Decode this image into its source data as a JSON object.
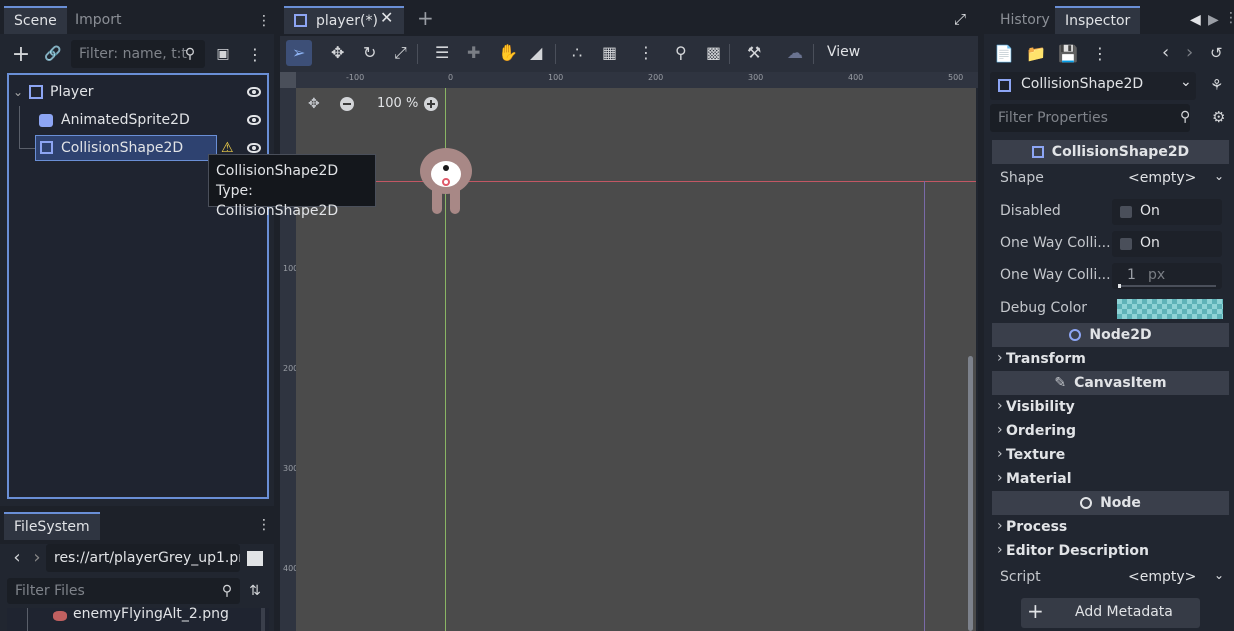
{
  "scene_dock": {
    "tabs": [
      {
        "label": "Scene"
      },
      {
        "label": "Import"
      }
    ],
    "filter_placeholder": "Filter: name, t:t",
    "nodes": [
      {
        "label": "Player"
      },
      {
        "label": "AnimatedSprite2D"
      },
      {
        "label": "CollisionShape2D"
      }
    ]
  },
  "tooltip": {
    "line1": "CollisionShape2D",
    "line2": "Type: CollisionShape2D"
  },
  "filesystem_dock": {
    "tab_label": "FileSystem",
    "path": "res://art/playerGrey_up1.pn",
    "filter_placeholder": "Filter Files",
    "items": [
      {
        "label": "enemyFlyingAlt_2.png"
      }
    ]
  },
  "editor": {
    "tab_label": "player(*)",
    "view_label": "View",
    "zoom_label": "100 %",
    "ruler_h": [
      "-100",
      "0",
      "100",
      "200",
      "300",
      "400",
      "500"
    ],
    "ruler_v": [
      "100",
      "200",
      "300",
      "400"
    ]
  },
  "inspector": {
    "tabs": [
      {
        "label": "History"
      },
      {
        "label": "Inspector"
      }
    ],
    "object_name": "CollisionShape2D",
    "filter_placeholder": "Filter Properties",
    "section_collision": "CollisionShape2D",
    "props": {
      "shape": {
        "name": "Shape",
        "value": "<empty>"
      },
      "disabled": {
        "name": "Disabled",
        "value": "On"
      },
      "one_way": {
        "name": "One Way Colli...",
        "value": "On"
      },
      "one_way_margin": {
        "name": "One Way Colli...",
        "value": "1",
        "unit": "px"
      },
      "debug_color": {
        "name": "Debug Color"
      }
    },
    "section_node2d": "Node2D",
    "transform": "Transform",
    "section_canvasitem": "CanvasItem",
    "canvas_groups": [
      {
        "label": "Visibility"
      },
      {
        "label": "Ordering"
      },
      {
        "label": "Texture"
      },
      {
        "label": "Material"
      }
    ],
    "section_node": "Node",
    "node_groups": [
      {
        "label": "Process"
      },
      {
        "label": "Editor Description"
      }
    ],
    "script": {
      "name": "Script",
      "value": "<empty>"
    },
    "add_metadata": "Add Metadata"
  },
  "colors": {
    "accent": "#6a8fd6",
    "viewport": "#4b4b4b",
    "warning": "#f5d44b",
    "x_axis": "#e05a6a",
    "y_axis": "#9ad06a"
  }
}
